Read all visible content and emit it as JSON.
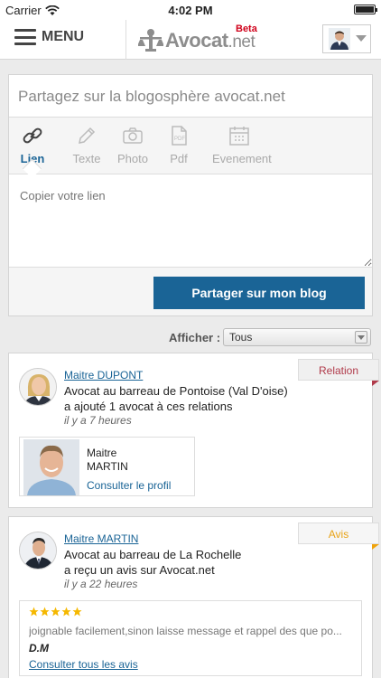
{
  "status_bar": {
    "carrier": "Carrier",
    "time": "4:02 PM",
    "battery_level": 1.0
  },
  "nav": {
    "menu_label": "MENU",
    "logo_text": "Avocat",
    "logo_tld": ".net",
    "beta": "Beta"
  },
  "share": {
    "title": "Partagez sur la blogosphère avocat.net",
    "tabs": [
      {
        "label": "Lien",
        "icon": "link-icon",
        "active": true
      },
      {
        "label": "Texte",
        "icon": "pencil-icon"
      },
      {
        "label": "Photo",
        "icon": "camera-icon"
      },
      {
        "label": "Pdf",
        "icon": "pdf-icon"
      },
      {
        "label": "Evenement",
        "icon": "calendar-icon"
      }
    ],
    "placeholder": "Copier votre lien",
    "button": "Partager sur mon blog"
  },
  "filter": {
    "label": "Afficher :",
    "value": "Tous"
  },
  "feed": [
    {
      "tag": "Relation",
      "author": "Maitre DUPONT",
      "line1": "Avocat au barreau de Pontoise (Val D'oise)",
      "line2": "a ajouté 1 avocat à ces relations",
      "time": "il y a 7 heures",
      "profile": {
        "title": "Maitre",
        "name": "MARTIN",
        "link": "Consulter le profil"
      }
    },
    {
      "tag": "Avis",
      "author": "Maitre MARTIN",
      "line1": "Avocat au barreau de La Rochelle",
      "line2": "a reçu un avis sur Avocat.net",
      "time": "il y a 22 heures",
      "review": {
        "rating": 5,
        "max": 5,
        "text": "joignable facilement,sinon laisse message et rappel des que po...",
        "author": "D.M",
        "link": "Consulter tous les avis"
      }
    }
  ],
  "colors": {
    "accent": "#1a6496",
    "relation": "#b03a4a",
    "avis": "#f0a30a",
    "star": "#f5b800"
  }
}
